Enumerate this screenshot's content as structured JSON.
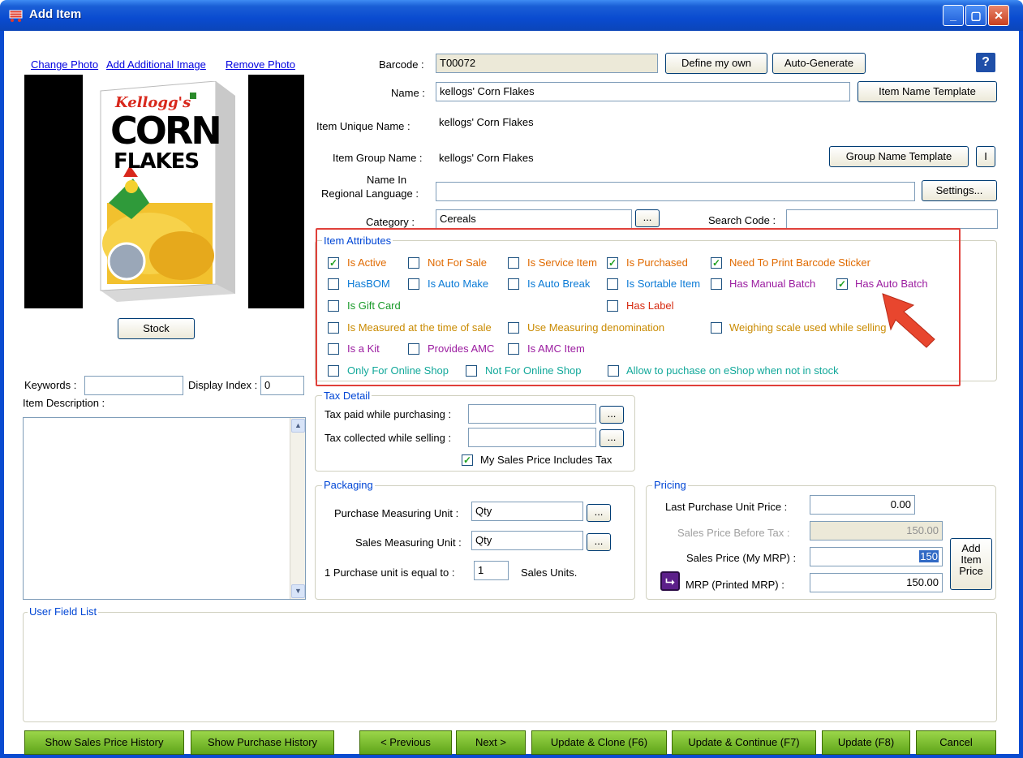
{
  "window": {
    "title": "Add Item",
    "icon": "cart-icon",
    "controls": [
      "minimize",
      "maximize",
      "close"
    ]
  },
  "photo": {
    "change_photo": "Change Photo",
    "add_additional_image": "Add Additional Image",
    "remove_photo": "Remove Photo",
    "product_brand": "Kellogg's",
    "product_name_1": "CORN",
    "product_name_2": "FLAKES",
    "stock_button": "Stock"
  },
  "form": {
    "barcode_label": "Barcode :",
    "barcode_value": "T00072",
    "define_my_own": "Define my own",
    "auto_generate": "Auto-Generate",
    "help": "?",
    "name_label": "Name :",
    "name_value": "kellogs' Corn Flakes",
    "item_name_template": "Item Name Template",
    "unique_name_label": "Item Unique Name :",
    "unique_name_value": "kellogs' Corn Flakes",
    "group_name_label": "Item Group Name :",
    "group_name_value": "kellogs' Corn Flakes",
    "group_name_template": "Group Name Template",
    "group_extra": "I",
    "regional_label_1": "Name In",
    "regional_label_2": "Regional Language :",
    "regional_value": "",
    "settings": "Settings...",
    "category_label": "Category :",
    "category_value": "Cereals",
    "category_browse": "...",
    "search_code_label": "Search Code :",
    "search_code_value": ""
  },
  "attributes": {
    "legend": "Item Attributes",
    "items": [
      {
        "label": "Is Active",
        "checked": true
      },
      {
        "label": "Not For Sale",
        "checked": false
      },
      {
        "label": "Is Service Item",
        "checked": false
      },
      {
        "label": "Is Purchased",
        "checked": true
      },
      {
        "label": "Need To Print Barcode Sticker",
        "checked": true
      },
      {
        "label": "HasBOM",
        "checked": false
      },
      {
        "label": "Is Auto Make",
        "checked": false
      },
      {
        "label": "Is Auto Break",
        "checked": false
      },
      {
        "label": "Is Sortable Item",
        "checked": false
      },
      {
        "label": "Has Manual Batch",
        "checked": false
      },
      {
        "label": "Has Auto Batch",
        "checked": true
      },
      {
        "label": "Is Gift Card",
        "checked": false
      },
      {
        "label": "Has Label",
        "checked": false
      },
      {
        "label": "Is Measured at the time of sale",
        "checked": false
      },
      {
        "label": "Use Measuring denomination",
        "checked": false
      },
      {
        "label": "Weighing scale used while selling",
        "checked": false
      },
      {
        "label": "Is a Kit",
        "checked": false
      },
      {
        "label": "Provides AMC",
        "checked": false
      },
      {
        "label": "Is AMC Item",
        "checked": false
      },
      {
        "label": "Only For Online Shop",
        "checked": false
      },
      {
        "label": "Not For Online Shop",
        "checked": false
      },
      {
        "label": "Allow to puchase on eShop when not in stock",
        "checked": false
      }
    ]
  },
  "left": {
    "keywords_label": "Keywords :",
    "keywords_value": "",
    "display_index_label": "Display Index :",
    "display_index_value": "0",
    "item_description_label": "Item Description :"
  },
  "tax": {
    "legend": "Tax Detail",
    "paid_label": "Tax paid while purchasing :",
    "collected_label": "Tax collected while selling :",
    "browse": "...",
    "includes_tax": "My Sales Price Includes Tax",
    "includes_tax_checked": true
  },
  "packaging": {
    "legend": "Packaging",
    "purchase_unit_label": "Purchase Measuring Unit :",
    "purchase_unit_value": "Qty",
    "sales_unit_label": "Sales Measuring Unit :",
    "sales_unit_value": "Qty",
    "browse": "...",
    "conversion_prefix": "1  Purchase unit is equal to :",
    "conversion_value": "1",
    "conversion_suffix": "Sales Units."
  },
  "pricing": {
    "legend": "Pricing",
    "last_purchase_label": "Last Purchase  Unit Price :",
    "last_purchase_value": "0.00",
    "before_tax_label": "Sales Price Before Tax :",
    "before_tax_value": "150.00",
    "sales_price_label": "Sales Price (My MRP) :",
    "sales_price_value": "150",
    "mrp_label": "MRP (Printed MRP) :",
    "mrp_value": "150.00",
    "add_item_price_1": "Add",
    "add_item_price_2": "Item",
    "add_item_price_3": "Price"
  },
  "user_fields": {
    "legend": "User Field List"
  },
  "footer": {
    "show_sales_history": "Show Sales Price History",
    "show_purchase_history": "Show Purchase History",
    "previous": "< Previous",
    "next": "Next >",
    "update_clone": "Update & Clone  (F6)",
    "update_continue": "Update & Continue (F7)",
    "update": "Update (F8)",
    "cancel": "Cancel"
  },
  "colors": {
    "title_bar": "#0a4bd0",
    "highlight_box": "#e0403a",
    "footer_button": "#7cc234",
    "legend_text": "#0046d5"
  }
}
